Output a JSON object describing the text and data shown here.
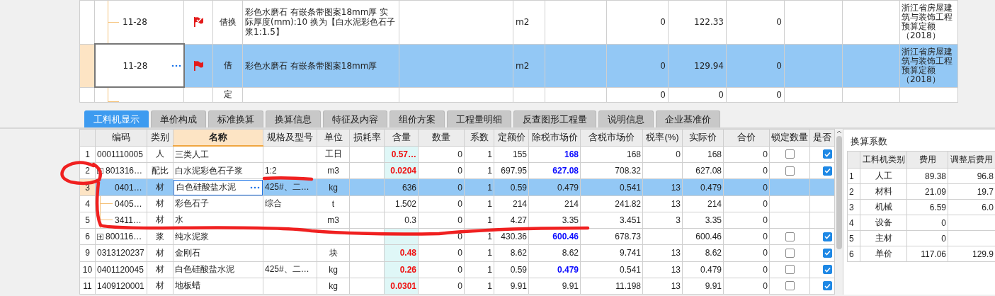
{
  "quota_grid": {
    "rows": [
      {
        "code": "11-28",
        "flagged": true,
        "flag_checked": true,
        "type": "借换",
        "name": "彩色水磨石 有嵌条带图案18mm厚  实际厚度(mm):10  换为【白水泥彩色石子浆1:1.5】",
        "unit": "m2",
        "column_9": "0",
        "column_10": "122.33",
        "column_11": "0",
        "column_14": "浙江省房屋建筑与装饰工程预算定额（2018）",
        "selected": false
      },
      {
        "code": "11-28",
        "flagged": true,
        "flag_checked": false,
        "type": "借",
        "name": "彩色水磨石 有嵌条带图案18mm厚",
        "unit": "m2",
        "column_9": "0",
        "column_10": "129.94",
        "column_11": "0",
        "column_14": "浙江省房屋建筑与装饰工程预算定额（2018）",
        "selected": true
      },
      {
        "flagged": false,
        "type": "定",
        "column_9": "0",
        "column_10": "0",
        "column_11": "0",
        "selected": false
      }
    ]
  },
  "tabs": [
    {
      "label": "工料机显示",
      "selected": true
    },
    {
      "label": "单价构成",
      "selected": false
    },
    {
      "label": "标准换算",
      "selected": false
    },
    {
      "label": "换算信息",
      "selected": false
    },
    {
      "label": "特征及内容",
      "selected": false
    },
    {
      "label": "组价方案",
      "selected": false
    },
    {
      "label": "工程量明细",
      "selected": false
    },
    {
      "label": "反查图形工程量",
      "selected": false
    },
    {
      "label": "说明信息",
      "selected": false
    },
    {
      "label": "企业基准价",
      "selected": false
    }
  ],
  "resource_table": {
    "columns": [
      {
        "label": "编码",
        "selected": false
      },
      {
        "label": "类别",
        "selected": false
      },
      {
        "label": "名称",
        "selected": true
      },
      {
        "label": "规格及型号",
        "selected": false
      },
      {
        "label": "单位",
        "selected": false
      },
      {
        "label": "损耗率",
        "selected": false
      },
      {
        "label": "含量",
        "selected": false
      },
      {
        "label": "数量",
        "selected": false
      },
      {
        "label": "系数",
        "selected": false
      },
      {
        "label": "定额价",
        "selected": false
      },
      {
        "label": "除税市场价",
        "selected": false
      },
      {
        "label": "含税市场价",
        "selected": false
      },
      {
        "label": "税率(%)",
        "selected": false
      },
      {
        "label": "实际价",
        "selected": false
      },
      {
        "label": "合价",
        "selected": false
      },
      {
        "label": "锁定数量",
        "selected": false
      },
      {
        "label": "是否",
        "selected": false
      }
    ],
    "rows": [
      {
        "number": "1",
        "code": "0001110005",
        "category": "人",
        "name": "三类人工",
        "unit": "工日",
        "content": "0.57…",
        "content_emphasis": true,
        "quantity": "0",
        "coefficient": "1",
        "quota_price": "155",
        "pretax_price": "168",
        "pretax_emphasis": true,
        "taxed_price": "168",
        "tax_rate": "0",
        "actual_price": "168",
        "total": "0",
        "locked": false,
        "included": true,
        "selected": false
      },
      {
        "number": "2",
        "code": "801316…",
        "expanded": true,
        "category": "配比",
        "name": "白水泥彩色石子浆",
        "spec": "1:2",
        "unit": "m3",
        "content": "0.0204",
        "content_emphasis": true,
        "quantity": "0",
        "coefficient": "1",
        "quota_price": "697.95",
        "pretax_price": "627.08",
        "pretax_emphasis": true,
        "taxed_price": "708.32",
        "actual_price": "627.08",
        "total": "0",
        "locked": false,
        "included": true,
        "selected": false,
        "children": [
          {
            "number": "3",
            "code": "0401…",
            "category": "材",
            "name": "白色硅酸盐水泥",
            "spec": "425#、二…",
            "unit": "kg",
            "content": "636",
            "content_emphasis": false,
            "quantity": "0",
            "coefficient": "1",
            "quota_price": "0.59",
            "pretax_price": "0.479",
            "pretax_emphasis": false,
            "taxed_price": "0.541",
            "tax_rate": "13",
            "actual_price": "0.479",
            "total": "0",
            "selected": true
          },
          {
            "number": "4",
            "code": "0405…",
            "category": "材",
            "name": "彩色石子",
            "spec": "综合",
            "unit": "t",
            "content": "1.502",
            "content_emphasis": false,
            "quantity": "0",
            "coefficient": "1",
            "quota_price": "214",
            "pretax_price": "214",
            "pretax_emphasis": false,
            "taxed_price": "241.82",
            "tax_rate": "13",
            "actual_price": "214",
            "total": "0",
            "selected": false
          },
          {
            "number": "5",
            "code": "3411…",
            "category": "材",
            "name": "水",
            "unit": "m3",
            "content": "0.3",
            "content_emphasis": false,
            "quantity": "0",
            "coefficient": "1",
            "quota_price": "4.27",
            "pretax_price": "3.35",
            "pretax_emphasis": false,
            "taxed_price": "3.451",
            "tax_rate": "3",
            "actual_price": "3.35",
            "total": "0",
            "selected": false
          }
        ]
      },
      {
        "number": "6",
        "code": "800116…",
        "expanded": false,
        "category": "浆",
        "name": "纯水泥浆",
        "content_emphasis": true,
        "quantity": "0",
        "coefficient": "1",
        "quota_price": "430.36",
        "pretax_price": "600.46",
        "pretax_emphasis": true,
        "taxed_price": "678.73",
        "actual_price": "600.46",
        "total": "0",
        "locked": false,
        "included": true,
        "selected": false
      },
      {
        "number": "9",
        "code": "0313120237",
        "category": "材",
        "name": "金刚石",
        "unit": "块",
        "content": "0.48",
        "content_emphasis": true,
        "quantity": "0",
        "coefficient": "1",
        "quota_price": "8.62",
        "pretax_price": "8.62",
        "pretax_emphasis": false,
        "taxed_price": "9.741",
        "tax_rate": "13",
        "actual_price": "8.62",
        "total": "0",
        "locked": false,
        "included": true,
        "selected": false
      },
      {
        "number": "10",
        "code": "0401120045",
        "category": "材",
        "name": "白色硅酸盐水泥",
        "spec": "425#、二…",
        "unit": "kg",
        "content": "0.26",
        "content_emphasis": true,
        "quantity": "0",
        "coefficient": "1",
        "quota_price": "0.59",
        "pretax_price": "0.479",
        "pretax_emphasis": true,
        "taxed_price": "0.541",
        "tax_rate": "13",
        "actual_price": "0.479",
        "total": "0",
        "locked": false,
        "included": true,
        "selected": false
      },
      {
        "number": "11",
        "code": "1409120001",
        "category": "材",
        "name": "地板蜡",
        "unit": "kg",
        "content": "0.0301",
        "content_emphasis": true,
        "quantity": "0",
        "coefficient": "1",
        "quota_price": "9.91",
        "pretax_price": "9.91",
        "pretax_emphasis": false,
        "taxed_price": "11.198",
        "tax_rate": "13",
        "actual_price": "9.91",
        "total": "0",
        "locked": false,
        "included": true,
        "selected": false
      }
    ]
  },
  "coefficient_panel": {
    "title": "换算系数",
    "columns": [
      "工料机类别",
      "费用",
      "调整后费用"
    ],
    "rows": [
      {
        "number": "1",
        "category": "人工",
        "cost": "89.38",
        "adjusted": "96.8"
      },
      {
        "number": "2",
        "category": "材料",
        "cost": "21.09",
        "adjusted": "19.7"
      },
      {
        "number": "3",
        "category": "机械",
        "cost": "6.59",
        "adjusted": "6.0"
      },
      {
        "number": "4",
        "category": "设备",
        "cost": "0"
      },
      {
        "number": "5",
        "category": "主材",
        "cost": "0"
      },
      {
        "number": "6",
        "category": "单价",
        "cost": "117.06",
        "adjusted": "129.9"
      }
    ]
  }
}
